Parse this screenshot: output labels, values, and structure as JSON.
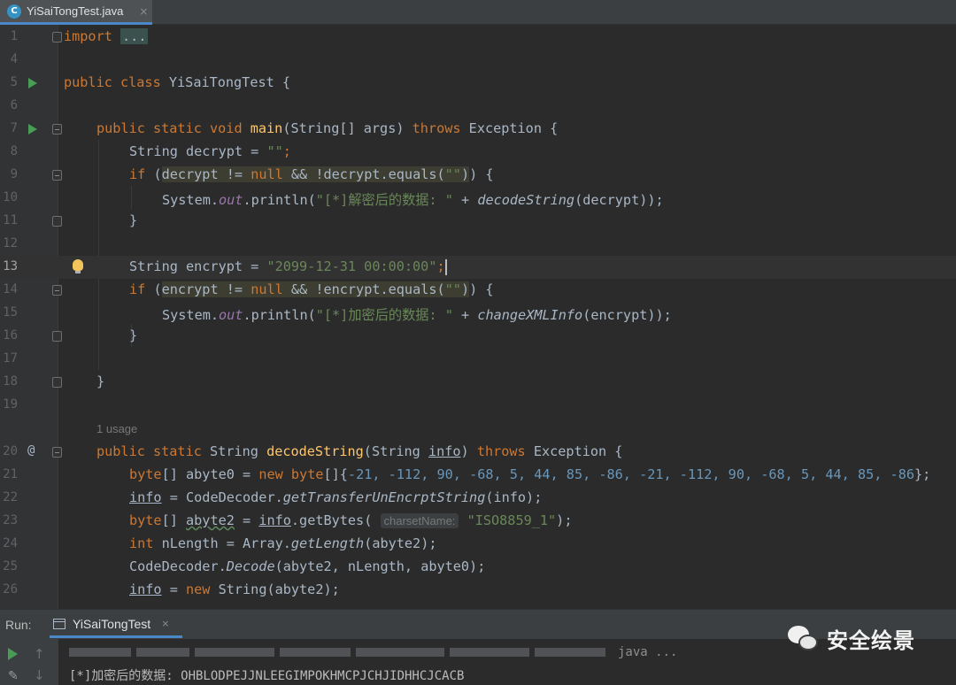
{
  "tab": {
    "file_name": "YiSaiTongTest.java",
    "close": "×",
    "icon_letter": "C"
  },
  "lines": [
    {
      "n": "1"
    },
    {
      "n": "4"
    },
    {
      "n": "5"
    },
    {
      "n": "6"
    },
    {
      "n": "7"
    },
    {
      "n": "8"
    },
    {
      "n": "9"
    },
    {
      "n": "10"
    },
    {
      "n": "11"
    },
    {
      "n": "12"
    },
    {
      "n": "13"
    },
    {
      "n": "14"
    },
    {
      "n": "15"
    },
    {
      "n": "16"
    },
    {
      "n": "17"
    },
    {
      "n": "18"
    },
    {
      "n": "19"
    },
    {
      "n": "20"
    },
    {
      "n": "21"
    },
    {
      "n": "22"
    },
    {
      "n": "23"
    },
    {
      "n": "24"
    },
    {
      "n": "25"
    },
    {
      "n": "26"
    }
  ],
  "code": {
    "import_kw": "import",
    "import_folded": "...",
    "class_decl_kw": "public class",
    "class_name": "YiSaiTongTest {",
    "main_kw": "public static void",
    "main_name": "main",
    "main_params": "(String[] args)",
    "throws": "throws",
    "exception": "Exception {",
    "decrypt_type": "String decrypt = ",
    "empty_str": "\"\"",
    "semicolon": ";",
    "if_kw": "if",
    "paren_open": " (",
    "decrypt_cond_a": "decrypt != ",
    "null_kw": "null",
    "decrypt_cond_b": " && !decrypt.equals(",
    "paren_close": ")",
    "brace_open": ") {",
    "system": "System.",
    "out": "out",
    "println": ".println(",
    "decrypt_label": "\"[*]解密后的数据: \"",
    "plus": " + ",
    "decode_call": "decodeString",
    "decrypt_arg": "(decrypt));",
    "brace_close": "}",
    "encrypt_type": "String encrypt = ",
    "encrypt_value": "\"2099-12-31 00:00:00\"",
    "encrypt_cond_a": "encrypt != ",
    "encrypt_cond_b": " && !encrypt.equals(",
    "encrypt_label": "\"[*]加密后的数据: \"",
    "change_call": "changeXMLInfo",
    "encrypt_arg": "(encrypt));",
    "usage": "1 usage",
    "decode_kw": "public static",
    "decode_ret": "String",
    "decode_name": "decodeString",
    "decode_params_a": "(String ",
    "decode_params_info": "info",
    "decode_params_b": ") ",
    "byte_kw": "byte",
    "abyte0_decl": "[] abyte0 = ",
    "new_kw": "new",
    "byte_arr": "byte",
    "arr_open": "[]{",
    "arr_values": "-21, -112, 90, -68, 5, 44, 85, -86, -21, -112, 90, -68, 5, 44, 85, -86",
    "arr_close": "};",
    "info": "info",
    "assign": " = ",
    "codedecoder": "CodeDecoder.",
    "get_transfer": "getTransferUnEncrptString",
    "info_arg": "(info);",
    "abyte2_decl_a": "[] ",
    "abyte2": "abyte2",
    "abyte2_decl_b": " = ",
    "getbytes": ".getBytes(",
    "charset_hint": "charsetName:",
    "charset": "\"ISO8859_1\"",
    "close_stmt": ");",
    "int_kw": "int",
    "nlength_decl": " nLength = Array.",
    "get_length": "getLength",
    "abyte2_arg": "(abyte2);",
    "decode_static": "Decode",
    "decode_args": "(abyte2, nLength, abyte0);",
    "string_ctor": " String(abyte2);"
  },
  "run": {
    "label": "Run:",
    "tab": "YiSaiTongTest",
    "close": "×",
    "cmd_tail": "java ...",
    "output": "[*]加密后的数据: OHBLODPEJJNLEEGIMPOKHMCPJCHJIDHHCJCACB"
  },
  "watermark": "安全绘景"
}
